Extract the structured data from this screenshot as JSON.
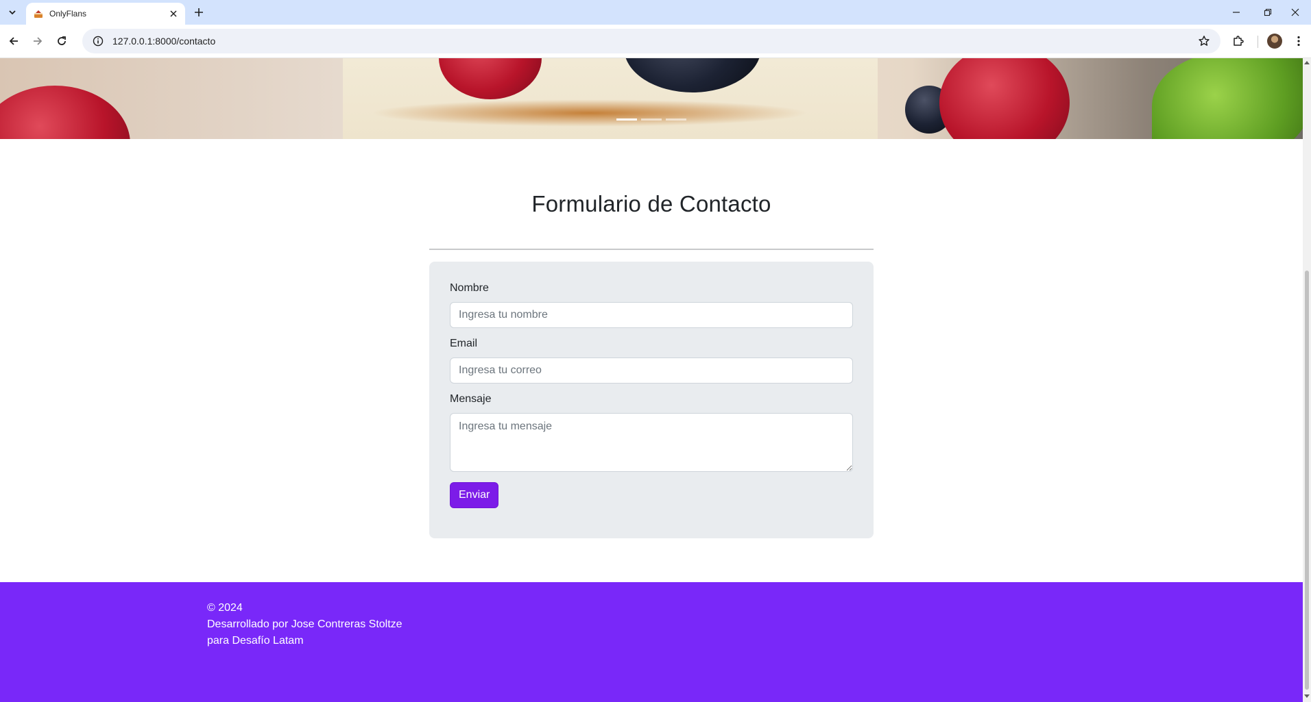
{
  "browser": {
    "tab_title": "OnlyFlans",
    "url": "127.0.0.1:8000/contacto"
  },
  "carousel": {
    "slide_count": 3,
    "active_index": 0
  },
  "contact": {
    "title": "Formulario de Contacto",
    "fields": {
      "nombre": {
        "label": "Nombre",
        "placeholder": "Ingresa tu nombre",
        "value": ""
      },
      "email": {
        "label": "Email",
        "placeholder": "Ingresa tu correo",
        "value": ""
      },
      "mensaje": {
        "label": "Mensaje",
        "placeholder": "Ingresa tu mensaje",
        "value": ""
      }
    },
    "submit_label": "Enviar"
  },
  "footer": {
    "line1": "© 2024",
    "line2": "Desarrollado por Jose Contreras Stoltze",
    "line3": "para Desafío Latam"
  },
  "colors": {
    "brand_purple": "#7928f9",
    "button_purple": "#7c1ce8",
    "form_bg": "#e9ecef",
    "tabstrip": "#d3e3fd"
  },
  "icons": {
    "tab_list": "chevron-down-icon",
    "favicon": "cake-icon",
    "tab_close": "close-icon",
    "new_tab": "plus-icon",
    "back": "arrow-left-icon",
    "forward": "arrow-right-icon",
    "reload": "reload-icon",
    "site_info": "info-icon",
    "bookmark": "star-icon",
    "extensions": "puzzle-icon",
    "menu": "kebab-menu-icon"
  }
}
